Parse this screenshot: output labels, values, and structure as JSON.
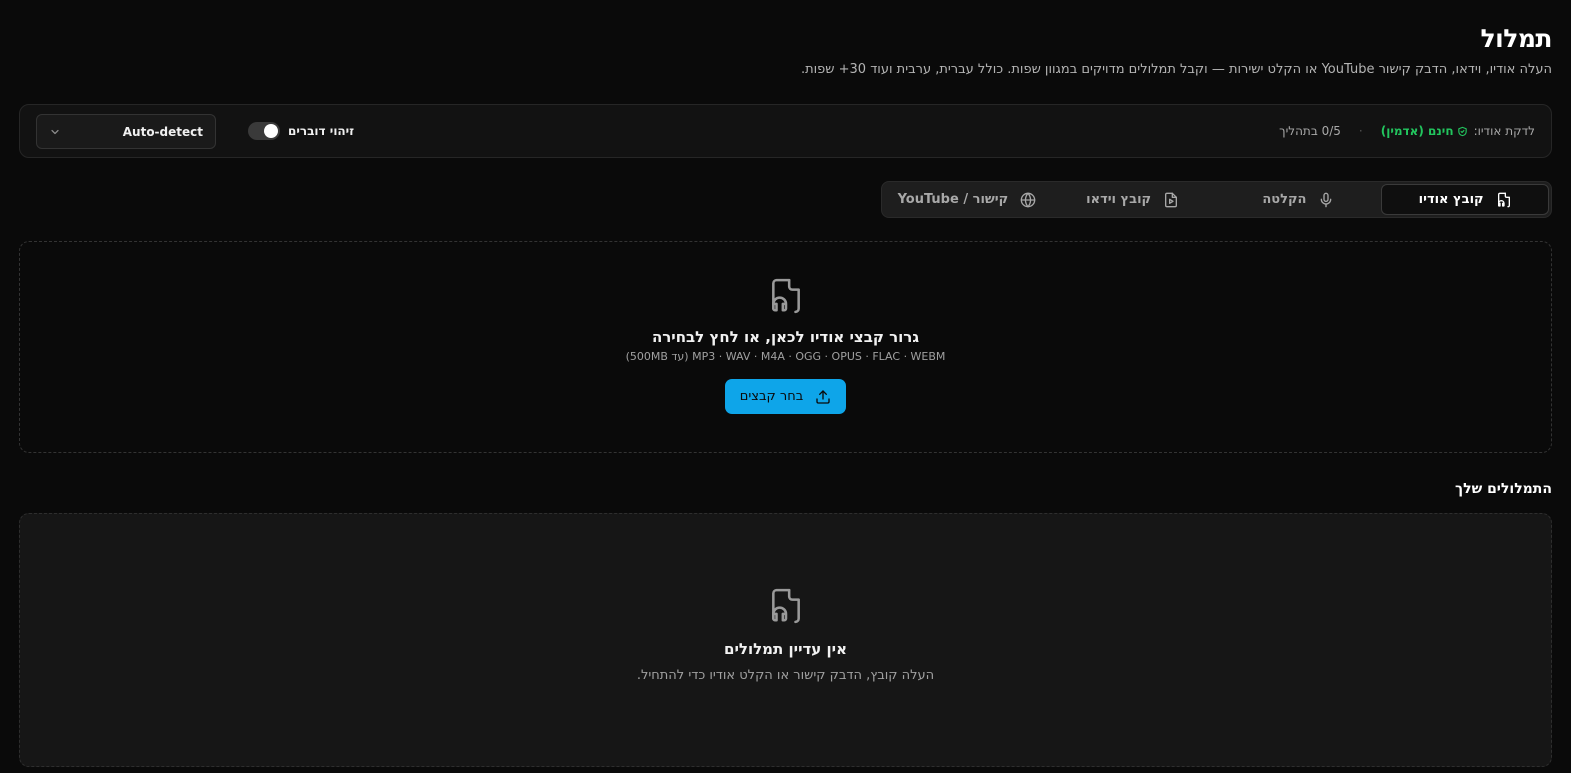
{
  "header": {
    "title": "תמלול",
    "subtitle": "העלה אודיו, וידאו, הדבק קישור YouTube או הקלט ישירות — וקבל תמלולים מדויקים במגוון שפות. כולל עברית, ערבית ועוד 30+ שפות."
  },
  "settings": {
    "quota_label": "לדקת אודיו:",
    "quota_free": "חינם (אדמין)",
    "quota_separator": "·",
    "quota_progress": "0/5 בתהליך",
    "speakers_label": "זיהוי דוברים",
    "speakers_enabled": false,
    "language_value": "Auto-detect"
  },
  "tabs": [
    {
      "label": "קובץ אודיו",
      "icon": "audio-file-icon",
      "active": true
    },
    {
      "label": "הקלטה",
      "icon": "mic-icon",
      "active": false
    },
    {
      "label": "קובץ וידאו",
      "icon": "video-file-icon",
      "active": false
    },
    {
      "label": "קישור / YouTube",
      "icon": "globe-icon",
      "active": false
    }
  ],
  "dropzone": {
    "title": "גרור קבצי אודיו לכאן, או לחץ לבחירה",
    "formats": "MP3 · WAV · M4A · OGG · OPUS · FLAC · WEBM (עד 500MB)",
    "button_label": "בחר קבצים"
  },
  "transcripts": {
    "section_title": "התמלולים שלך",
    "empty_title": "אין עדיין תמלולים",
    "empty_text": "העלה קובץ, הדבק קישור או הקלט אודיו כדי להתחיל."
  },
  "colors": {
    "background": "#0a0a0a",
    "accent": "#0ea5e9",
    "free_badge": "#22c55e"
  }
}
